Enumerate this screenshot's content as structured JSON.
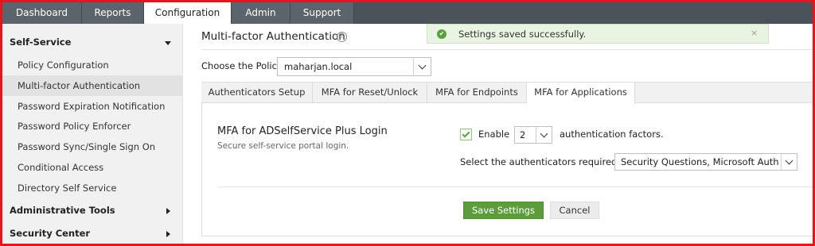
{
  "top_tabs": [
    "Dashboard",
    "Reports",
    "Configuration",
    "Admin",
    "Support"
  ],
  "sidebar": {
    "self_service": "Self-Service",
    "items": [
      "Policy Configuration",
      "Multi-factor Authentication",
      "Password Expiration Notification",
      "Password Policy Enforcer",
      "Password Sync/Single Sign On",
      "Conditional Access",
      "Directory Self Service"
    ],
    "administrative_tools": "Administrative Tools",
    "security_center": "Security Center"
  },
  "main": {
    "title": "Multi-factor Authentication",
    "help": "?",
    "toast": {
      "text": "Settings saved successfully.",
      "close": "×"
    },
    "policy_label": "Choose the Policy",
    "policy_value": "maharjan.local",
    "tabs": [
      "Authenticators Setup",
      "MFA for Reset/Unlock",
      "MFA for Endpoints",
      "MFA for Applications"
    ],
    "section_title": "MFA for ADSelfService Plus Login",
    "section_desc": "Secure self-service portal login.",
    "enable_label": "Enable",
    "factor_count": "2",
    "factors_label": "authentication factors.",
    "authenticators_label": "Select the authenticators required",
    "authenticators_value": "Security Questions, Microsoft Authenticator",
    "save_label": "Save Settings",
    "cancel_label": "Cancel"
  },
  "colors": {
    "frame": "#e8141c",
    "nav_bg": "#4b5259",
    "save_button": "#5d9c3b",
    "toast_bg": "#e9f4e2"
  }
}
